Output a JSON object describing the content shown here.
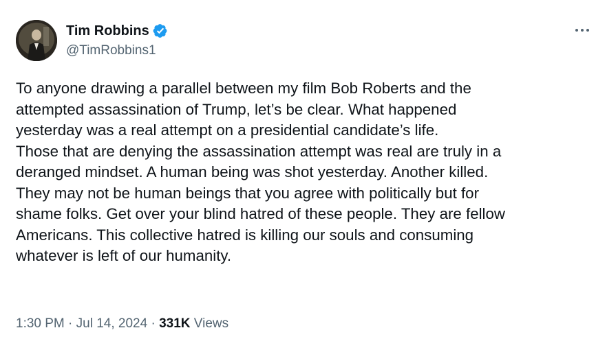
{
  "author": {
    "display_name": "Tim Robbins",
    "handle": "@TimRobbins1",
    "verified_icon": "verified-badge-icon",
    "badge_color": "#1d9bf0"
  },
  "menu": {
    "more_icon": "more-options-icon",
    "glyph": "···"
  },
  "tweet": {
    "lines": [
      "To anyone drawing a parallel between my film Bob Roberts and the",
      "attempted assassination of Trump, let’s be clear. What happened",
      "yesterday was a real attempt on a presidential candidate’s life.",
      "Those that are denying the assassination attempt was real are truly in a",
      "deranged mindset. A human being was shot yesterday. Another killed.",
      "They may not be human beings that you agree with politically but for",
      "shame folks. Get over your blind hatred of these people. They are fellow",
      "Americans. This collective hatred is killing our souls and consuming",
      "whatever is left of our humanity."
    ]
  },
  "meta": {
    "time": "1:30 PM",
    "separator": " · ",
    "date": "Jul 14, 2024",
    "separator2": " · ",
    "views_count": "331K",
    "views_label": " Views"
  }
}
